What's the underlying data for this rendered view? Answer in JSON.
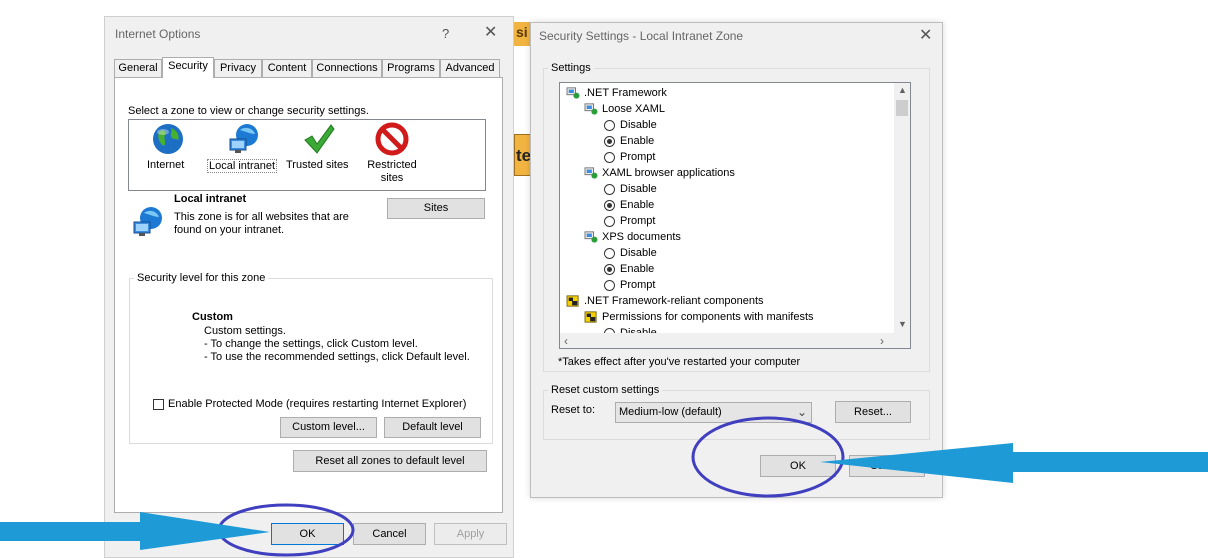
{
  "internet_options": {
    "title": "Internet Options",
    "help": "?",
    "close": "✕",
    "tabs": [
      "General",
      "Security",
      "Privacy",
      "Content",
      "Connections",
      "Programs",
      "Advanced"
    ],
    "zone_prompt": "Select a zone to view or change security settings.",
    "zones": [
      "Internet",
      "Local intranet",
      "Trusted sites",
      "Restricted sites"
    ],
    "zone_info": {
      "name": "Local intranet",
      "description_line1": "This zone is for all websites that are",
      "description_line2": "found on your intranet."
    },
    "sites_button": "Sites",
    "security_level": {
      "group_label": "Security level for this zone",
      "level": "Custom",
      "line1": "Custom settings.",
      "line2": "- To change the settings, click Custom level.",
      "line3": "- To use the recommended settings, click Default level."
    },
    "protected_mode": "Enable Protected Mode (requires restarting Internet Explorer)",
    "custom_level_button": "Custom level...",
    "default_level_button": "Default level",
    "reset_all_button": "Reset all zones to default level",
    "ok": "OK",
    "cancel": "Cancel",
    "apply": "Apply"
  },
  "bg_fragment": {
    "line1": "si",
    "line2": "te"
  },
  "security_settings": {
    "title": "Security Settings - Local Intranet Zone",
    "close": "✕",
    "settings_label": "Settings",
    "tree": [
      {
        "type": "category",
        "label": ".NET Framework",
        "indent": 0
      },
      {
        "type": "category",
        "label": "Loose XAML",
        "indent": 1
      },
      {
        "type": "radio",
        "label": "Disable",
        "indent": 2,
        "checked": false
      },
      {
        "type": "radio",
        "label": "Enable",
        "indent": 2,
        "checked": true
      },
      {
        "type": "radio",
        "label": "Prompt",
        "indent": 2,
        "checked": false
      },
      {
        "type": "category",
        "label": "XAML browser applications",
        "indent": 1
      },
      {
        "type": "radio",
        "label": "Disable",
        "indent": 2,
        "checked": false
      },
      {
        "type": "radio",
        "label": "Enable",
        "indent": 2,
        "checked": true
      },
      {
        "type": "radio",
        "label": "Prompt",
        "indent": 2,
        "checked": false
      },
      {
        "type": "category",
        "label": "XPS documents",
        "indent": 1
      },
      {
        "type": "radio",
        "label": "Disable",
        "indent": 2,
        "checked": false
      },
      {
        "type": "radio",
        "label": "Enable",
        "indent": 2,
        "checked": true
      },
      {
        "type": "radio",
        "label": "Prompt",
        "indent": 2,
        "checked": false
      },
      {
        "type": "category2",
        "label": ".NET Framework-reliant components",
        "indent": 0
      },
      {
        "type": "category2",
        "label": "Permissions for components with manifests",
        "indent": 1
      },
      {
        "type": "radio",
        "label": "Disable",
        "indent": 2,
        "checked": false
      }
    ],
    "note": "*Takes effect after you've restarted your computer",
    "reset_group_label": "Reset custom settings",
    "reset_to_label": "Reset to:",
    "reset_to_value": "Medium-low (default)",
    "reset_button": "Reset...",
    "ok": "OK",
    "cancel": "Cancel"
  },
  "annotation_colors": {
    "arrow": "#1e9bd7",
    "circle": "#3f3fbf"
  }
}
